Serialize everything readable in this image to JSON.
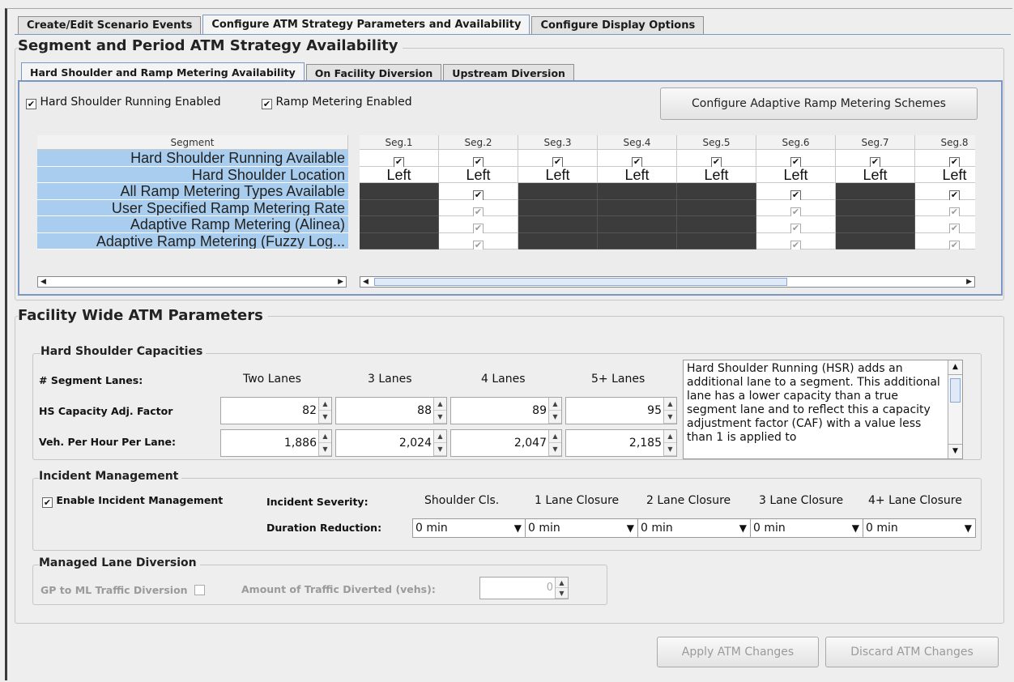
{
  "tabs": [
    "Create/Edit Scenario Events",
    "Configure ATM Strategy Parameters and Availability",
    "Configure Display Options"
  ],
  "active_tab": 1,
  "availability": {
    "title": "Segment and Period ATM Strategy Availability",
    "subtabs": [
      "Hard Shoulder and Ramp Metering Availability",
      "On Facility Diversion",
      "Upstream Diversion"
    ],
    "hsr_enabled_label": "Hard Shoulder Running Enabled",
    "rm_enabled_label": "Ramp Metering Enabled",
    "config_button": "Configure Adaptive Ramp Metering Schemes",
    "table": {
      "corner": "Segment",
      "columns": [
        "Seg.1",
        "Seg.2",
        "Seg.3",
        "Seg.4",
        "Seg.5",
        "Seg.6",
        "Seg.7",
        "Seg.8"
      ],
      "rows": [
        {
          "label": "Hard Shoulder Running Available",
          "cells": [
            "check",
            "check",
            "check",
            "check",
            "check",
            "check",
            "check",
            "check"
          ]
        },
        {
          "label": "Hard Shoulder Location",
          "cells": [
            "Left",
            "Left",
            "Left",
            "Left",
            "Left",
            "Left",
            "Left",
            "Left"
          ]
        },
        {
          "label": "All Ramp Metering Types Available",
          "cells": [
            "dark",
            "check",
            "dark",
            "dark",
            "dark",
            "check",
            "dark",
            "check"
          ]
        },
        {
          "label": "User Specified Ramp Metering Rate",
          "cells": [
            "dark",
            "dim",
            "dark",
            "dark",
            "dark",
            "dim",
            "dark",
            "dim"
          ]
        },
        {
          "label": "Adaptive Ramp Metering (Alinea)",
          "cells": [
            "dark",
            "dim",
            "dark",
            "dark",
            "dark",
            "dim",
            "dark",
            "dim"
          ]
        },
        {
          "label": "Adaptive Ramp Metering (Fuzzy Log...",
          "cells": [
            "dark",
            "dim",
            "dark",
            "dark",
            "dark",
            "dim",
            "dark",
            "dim"
          ]
        }
      ]
    }
  },
  "facility": {
    "title": "Facility Wide ATM Parameters",
    "hs_capacities": {
      "title": "Hard Shoulder Capacities",
      "lanes_label": "# Segment Lanes:",
      "lane_headers": [
        "Two Lanes",
        "3 Lanes",
        "4 Lanes",
        "5+ Lanes"
      ],
      "caf_label": "HS Capacity Adj. Factor",
      "caf_values": [
        "82",
        "88",
        "89",
        "95"
      ],
      "vph_label": "Veh. Per Hour Per Lane:",
      "vph_values": [
        "1,886",
        "2,024",
        "2,047",
        "2,185"
      ],
      "description": "Hard Shoulder Running (HSR) adds an additional lane to a segment.  This additional lane has a lower capacity than a true segment lane and to reflect this a capacity adjustment factor (CAF) with a value less than 1 is applied to"
    },
    "incident": {
      "title": "Incident Management",
      "enable_label": "Enable Incident Management",
      "severity_label": "Incident Severity:",
      "severity_headers": [
        "Shoulder Cls.",
        "1 Lane Closure",
        "2 Lane Closure",
        "3 Lane Closure",
        "4+ Lane Closure"
      ],
      "duration_label": "Duration Reduction:",
      "duration_values": [
        "0 min",
        "0 min",
        "0 min",
        "0 min",
        "0 min"
      ]
    },
    "managed_lane": {
      "title": "Managed Lane Diversion",
      "gp_label": "GP to ML Traffic Diversion",
      "amount_label": "Amount of Traffic Diverted (vehs):",
      "amount_value": "0"
    }
  },
  "buttons": {
    "apply": "Apply ATM Changes",
    "discard": "Discard ATM Changes"
  }
}
